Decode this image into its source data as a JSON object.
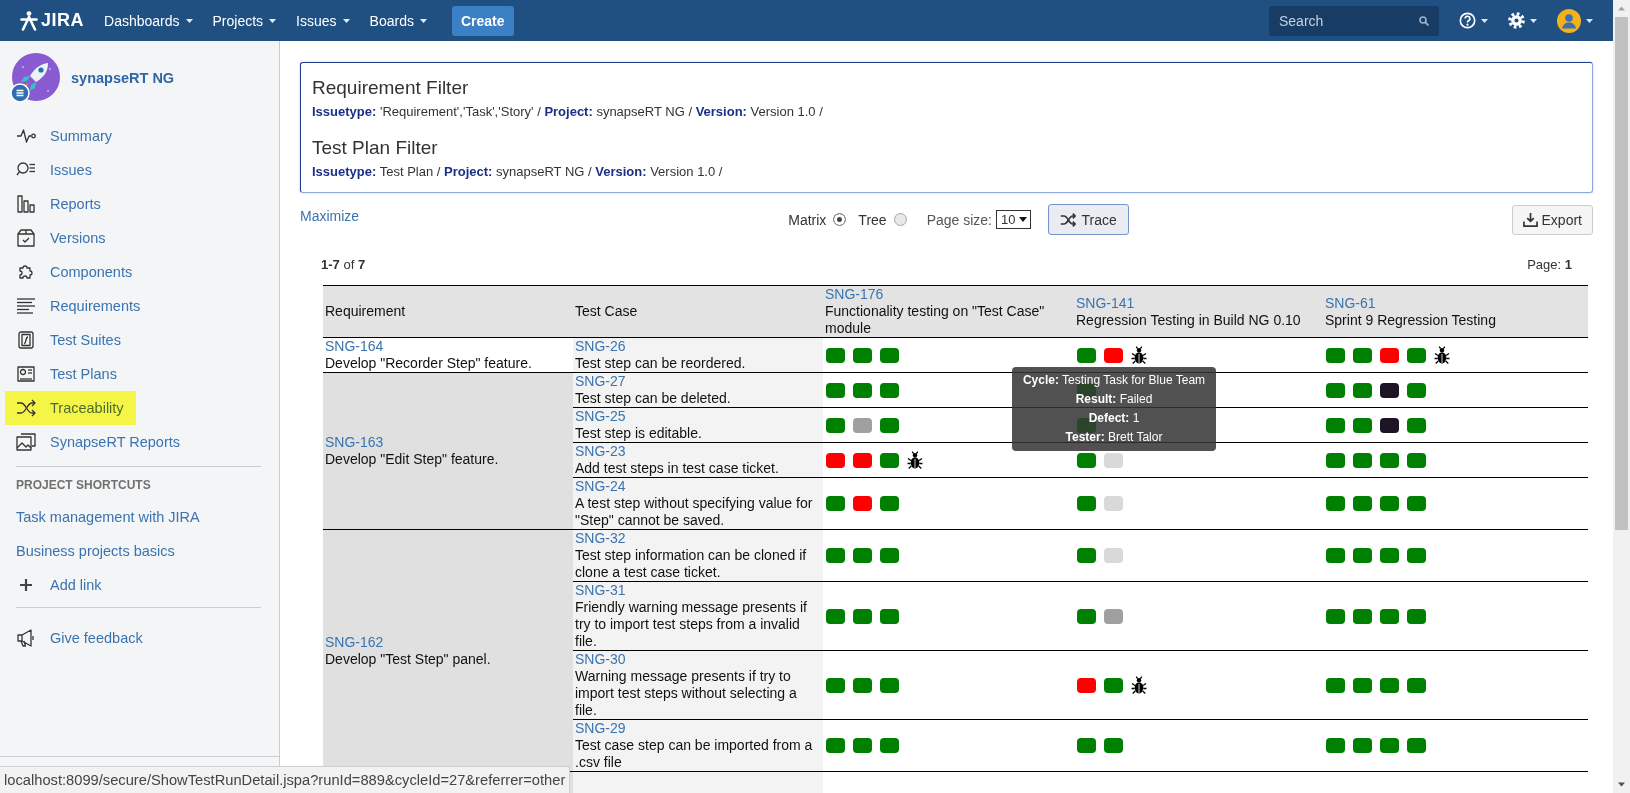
{
  "topbar": {
    "logo": "JIRA",
    "menus": [
      {
        "label": "Dashboards"
      },
      {
        "label": "Projects"
      },
      {
        "label": "Issues"
      },
      {
        "label": "Boards"
      }
    ],
    "create": "Create",
    "search": {
      "placeholder": "Search"
    }
  },
  "sidebar": {
    "project": "synapseRT NG",
    "items": [
      {
        "label": "Summary",
        "selected": false
      },
      {
        "label": "Issues",
        "selected": false
      },
      {
        "label": "Reports",
        "selected": false
      },
      {
        "label": "Versions",
        "selected": false
      },
      {
        "label": "Components",
        "selected": false
      },
      {
        "label": "Requirements",
        "selected": false
      },
      {
        "label": "Test Suites",
        "selected": false
      },
      {
        "label": "Test Plans",
        "selected": false
      },
      {
        "label": "Traceability",
        "selected": true
      },
      {
        "label": "SynapseRT Reports",
        "selected": false
      }
    ],
    "shortcuts_heading": "PROJECT SHORTCUTS",
    "shortcuts": [
      {
        "label": "Task management with JIRA"
      },
      {
        "label": "Business projects basics"
      }
    ],
    "add_link": "Add link",
    "feedback": "Give feedback"
  },
  "filters": [
    {
      "title": "Requirement Filter",
      "criteria": "**Issuetype:** 'Requirement','Task','Story' / **Project:** synapseRT NG / **Version:** Version 1.0 /"
    },
    {
      "title": "Test Plan Filter",
      "criteria": "**Issuetype:** Test Plan / **Project:** synapseRT NG / **Version:** Version 1.0 /"
    }
  ],
  "toolbar": {
    "maximize": "Maximize",
    "views": [
      {
        "label": "Matrix",
        "selected": true
      },
      {
        "label": "Tree",
        "selected": false
      }
    ],
    "page_size_label": "Page size:",
    "page_size": "10",
    "trace": "Trace",
    "export": "Export"
  },
  "summary": {
    "range": "**1-7** of **7**",
    "page": "Page: **1**"
  },
  "table": {
    "columns": [
      {
        "label": "Requirement"
      },
      {
        "label": "Test Case"
      },
      {
        "key": "SNG-176",
        "label": "Functionality testing on \"Test Case\" module"
      },
      {
        "key": "SNG-141",
        "label": "Regression Testing in Build NG 0.10"
      },
      {
        "key": "SNG-61",
        "label": "Sprint 9 Regression Testing"
      }
    ],
    "groups": [
      {
        "requirement": {
          "key": "SNG-164",
          "summary": "Develop \"Recorder Step\" feature."
        },
        "shaded": false,
        "tests": [
          {
            "key": "SNG-26",
            "summary": "Test step can be reordered.",
            "results": [
              {
                "marks": [
                  {
                    "kind": "status",
                    "color": "#008000"
                  },
                  {
                    "kind": "status",
                    "color": "#008000"
                  },
                  {
                    "kind": "status",
                    "color": "#008000"
                  }
                ]
              },
              {
                "marks": [
                  {
                    "kind": "status",
                    "color": "#008000"
                  },
                  {
                    "kind": "status",
                    "color": "#ff0000"
                  },
                  {
                    "kind": "defect"
                  }
                ]
              },
              {
                "marks": [
                  {
                    "kind": "status",
                    "color": "#008000"
                  },
                  {
                    "kind": "status",
                    "color": "#008000"
                  },
                  {
                    "kind": "status",
                    "color": "#ff0000"
                  },
                  {
                    "kind": "status",
                    "color": "#008000"
                  },
                  {
                    "kind": "defect"
                  }
                ]
              }
            ]
          }
        ]
      },
      {
        "requirement": {
          "key": "SNG-163",
          "summary": "Develop \"Edit Step\" feature."
        },
        "shaded": true,
        "tests": [
          {
            "key": "SNG-27",
            "summary": "Test step can be deleted.",
            "results": [
              {
                "marks": [
                  {
                    "kind": "status",
                    "color": "#008000"
                  },
                  {
                    "kind": "status",
                    "color": "#008000"
                  },
                  {
                    "kind": "status",
                    "color": "#008000"
                  }
                ]
              },
              {
                "marks": [
                  {
                    "kind": "status",
                    "color": "#2b452b"
                  }
                ]
              },
              {
                "marks": [
                  {
                    "kind": "status",
                    "color": "#008000"
                  },
                  {
                    "kind": "status",
                    "color": "#008000"
                  },
                  {
                    "kind": "status",
                    "color": "#1d1426"
                  },
                  {
                    "kind": "status",
                    "color": "#008000"
                  }
                ]
              }
            ]
          },
          {
            "key": "SNG-25",
            "summary": "Test step is editable.",
            "results": [
              {
                "marks": [
                  {
                    "kind": "status",
                    "color": "#008000"
                  },
                  {
                    "kind": "status",
                    "color": "#a0a0a0"
                  },
                  {
                    "kind": "status",
                    "color": "#008000"
                  }
                ]
              },
              {
                "marks": [
                  {
                    "kind": "status",
                    "color": "#2b452b"
                  }
                ]
              },
              {
                "marks": [
                  {
                    "kind": "status",
                    "color": "#008000"
                  },
                  {
                    "kind": "status",
                    "color": "#008000"
                  },
                  {
                    "kind": "status",
                    "color": "#1d1426"
                  },
                  {
                    "kind": "status",
                    "color": "#008000"
                  }
                ]
              }
            ]
          },
          {
            "key": "SNG-23",
            "summary": "Add test steps in test case ticket.",
            "results": [
              {
                "marks": [
                  {
                    "kind": "status",
                    "color": "#ff0000"
                  },
                  {
                    "kind": "status",
                    "color": "#ff0000"
                  },
                  {
                    "kind": "status",
                    "color": "#008000"
                  },
                  {
                    "kind": "defect"
                  }
                ]
              },
              {
                "marks": [
                  {
                    "kind": "status",
                    "color": "#008000"
                  },
                  {
                    "kind": "status",
                    "color": "#d9d9d9"
                  }
                ]
              },
              {
                "marks": [
                  {
                    "kind": "status",
                    "color": "#008000"
                  },
                  {
                    "kind": "status",
                    "color": "#008000"
                  },
                  {
                    "kind": "status",
                    "color": "#008000"
                  },
                  {
                    "kind": "status",
                    "color": "#008000"
                  }
                ]
              }
            ]
          },
          {
            "key": "SNG-24",
            "summary": "A test step without specifying value for \"Step\" cannot be saved.",
            "results": [
              {
                "marks": [
                  {
                    "kind": "status",
                    "color": "#008000"
                  },
                  {
                    "kind": "status",
                    "color": "#ff0000"
                  },
                  {
                    "kind": "status",
                    "color": "#008000"
                  }
                ]
              },
              {
                "marks": [
                  {
                    "kind": "status",
                    "color": "#008000"
                  },
                  {
                    "kind": "status",
                    "color": "#d9d9d9"
                  }
                ]
              },
              {
                "marks": [
                  {
                    "kind": "status",
                    "color": "#008000"
                  },
                  {
                    "kind": "status",
                    "color": "#008000"
                  },
                  {
                    "kind": "status",
                    "color": "#008000"
                  },
                  {
                    "kind": "status",
                    "color": "#008000"
                  }
                ]
              }
            ]
          }
        ]
      },
      {
        "requirement": {
          "key": "SNG-162",
          "summary": "Develop \"Test Step\" panel."
        },
        "shaded": true,
        "tests": [
          {
            "key": "SNG-32",
            "summary": "Test step information can be cloned if clone a test case ticket.",
            "results": [
              {
                "marks": [
                  {
                    "kind": "status",
                    "color": "#008000"
                  },
                  {
                    "kind": "status",
                    "color": "#008000"
                  },
                  {
                    "kind": "status",
                    "color": "#008000"
                  }
                ]
              },
              {
                "marks": [
                  {
                    "kind": "status",
                    "color": "#008000"
                  },
                  {
                    "kind": "status",
                    "color": "#d9d9d9"
                  }
                ]
              },
              {
                "marks": [
                  {
                    "kind": "status",
                    "color": "#008000"
                  },
                  {
                    "kind": "status",
                    "color": "#008000"
                  },
                  {
                    "kind": "status",
                    "color": "#008000"
                  },
                  {
                    "kind": "status",
                    "color": "#008000"
                  }
                ]
              }
            ]
          },
          {
            "key": "SNG-31",
            "summary": "Friendly warning message presents if try to import test steps from a invalid file.",
            "results": [
              {
                "marks": [
                  {
                    "kind": "status",
                    "color": "#008000"
                  },
                  {
                    "kind": "status",
                    "color": "#008000"
                  },
                  {
                    "kind": "status",
                    "color": "#008000"
                  }
                ]
              },
              {
                "marks": [
                  {
                    "kind": "status",
                    "color": "#008000"
                  },
                  {
                    "kind": "status",
                    "color": "#a0a0a0"
                  }
                ]
              },
              {
                "marks": [
                  {
                    "kind": "status",
                    "color": "#008000"
                  },
                  {
                    "kind": "status",
                    "color": "#008000"
                  },
                  {
                    "kind": "status",
                    "color": "#008000"
                  },
                  {
                    "kind": "status",
                    "color": "#008000"
                  }
                ]
              }
            ]
          },
          {
            "key": "SNG-30",
            "summary": "Warning message presents if try to import test steps without selecting a file.",
            "results": [
              {
                "marks": [
                  {
                    "kind": "status",
                    "color": "#008000"
                  },
                  {
                    "kind": "status",
                    "color": "#008000"
                  },
                  {
                    "kind": "status",
                    "color": "#008000"
                  }
                ]
              },
              {
                "marks": [
                  {
                    "kind": "status",
                    "color": "#ff0000"
                  },
                  {
                    "kind": "status",
                    "color": "#008000"
                  },
                  {
                    "kind": "defect"
                  }
                ]
              },
              {
                "marks": [
                  {
                    "kind": "status",
                    "color": "#008000"
                  },
                  {
                    "kind": "status",
                    "color": "#008000"
                  },
                  {
                    "kind": "status",
                    "color": "#008000"
                  },
                  {
                    "kind": "status",
                    "color": "#008000"
                  }
                ]
              }
            ]
          },
          {
            "key": "SNG-29",
            "summary": "Test case step can be imported from a .csv file",
            "results": [
              {
                "marks": [
                  {
                    "kind": "status",
                    "color": "#008000"
                  },
                  {
                    "kind": "status",
                    "color": "#008000"
                  },
                  {
                    "kind": "status",
                    "color": "#008000"
                  }
                ]
              },
              {
                "marks": [
                  {
                    "kind": "status",
                    "color": "#008000"
                  },
                  {
                    "kind": "status",
                    "color": "#008000"
                  }
                ]
              },
              {
                "marks": [
                  {
                    "kind": "status",
                    "color": "#008000"
                  },
                  {
                    "kind": "status",
                    "color": "#008000"
                  },
                  {
                    "kind": "status",
                    "color": "#008000"
                  },
                  {
                    "kind": "status",
                    "color": "#008000"
                  }
                ]
              }
            ]
          }
        ]
      }
    ]
  },
  "tooltip": {
    "lines": [
      "**Cycle:** Testing Task for Blue Team",
      "**Result:** Failed",
      "**Defect:** 1",
      "**Tester:** Brett Talor"
    ]
  },
  "status_bar": "localhost:8099/secure/ShowTestRunDetail.jspa?runId=889&cycleId=27&referrer=other"
}
